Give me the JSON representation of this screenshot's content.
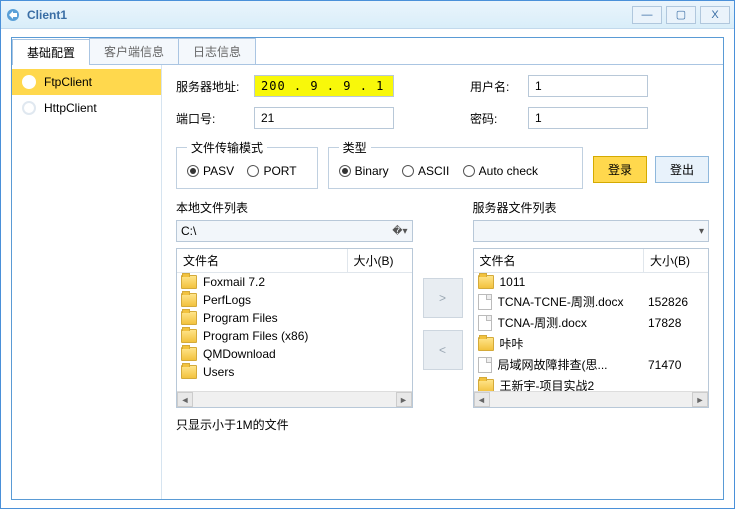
{
  "title": "Client1",
  "tabs": [
    "基础配置",
    "客户端信息",
    "日志信息"
  ],
  "sidebar": {
    "items": [
      {
        "label": "FtpClient"
      },
      {
        "label": "HttpClient"
      }
    ]
  },
  "form": {
    "server_label": "服务器地址:",
    "server_value": "200 . 9 . 9 . 1",
    "port_label": "端口号:",
    "port_value": "21",
    "user_label": "用户名:",
    "user_value": "1",
    "pass_label": "密码:",
    "pass_value": "1"
  },
  "transfer_mode": {
    "legend": "文件传输模式",
    "options": [
      "PASV",
      "PORT"
    ],
    "selected": "PASV"
  },
  "type_mode": {
    "legend": "类型",
    "options": [
      "Binary",
      "ASCII",
      "Auto check"
    ],
    "selected": "Binary"
  },
  "buttons": {
    "login": "登录",
    "logout": "登出"
  },
  "local": {
    "title": "本地文件列表",
    "drive": "C:\\",
    "col_name": "文件名",
    "col_size": "大小(B)",
    "rows": [
      {
        "icon": "folder",
        "name": "Foxmail 7.2",
        "size": ""
      },
      {
        "icon": "folder",
        "name": "PerfLogs",
        "size": ""
      },
      {
        "icon": "folder",
        "name": "Program Files",
        "size": ""
      },
      {
        "icon": "folder",
        "name": "Program Files (x86)",
        "size": ""
      },
      {
        "icon": "folder",
        "name": "QMDownload",
        "size": ""
      },
      {
        "icon": "folder",
        "name": "Users",
        "size": ""
      }
    ]
  },
  "remote": {
    "title": "服务器文件列表",
    "drive": "",
    "col_name": "文件名",
    "col_size": "大小(B)",
    "rows": [
      {
        "icon": "folder",
        "name": "1011",
        "size": ""
      },
      {
        "icon": "doc",
        "name": "TCNA-TCNE-周测.docx",
        "size": "152826"
      },
      {
        "icon": "doc",
        "name": "TCNA-周测.docx",
        "size": "17828"
      },
      {
        "icon": "folder",
        "name": "咔咔",
        "size": ""
      },
      {
        "icon": "doc",
        "name": "局域网故障排查(思...",
        "size": "71470"
      },
      {
        "icon": "folder",
        "name": "王新宇-项目实战2",
        "size": ""
      }
    ]
  },
  "footer": "只显示小于1M的文件"
}
